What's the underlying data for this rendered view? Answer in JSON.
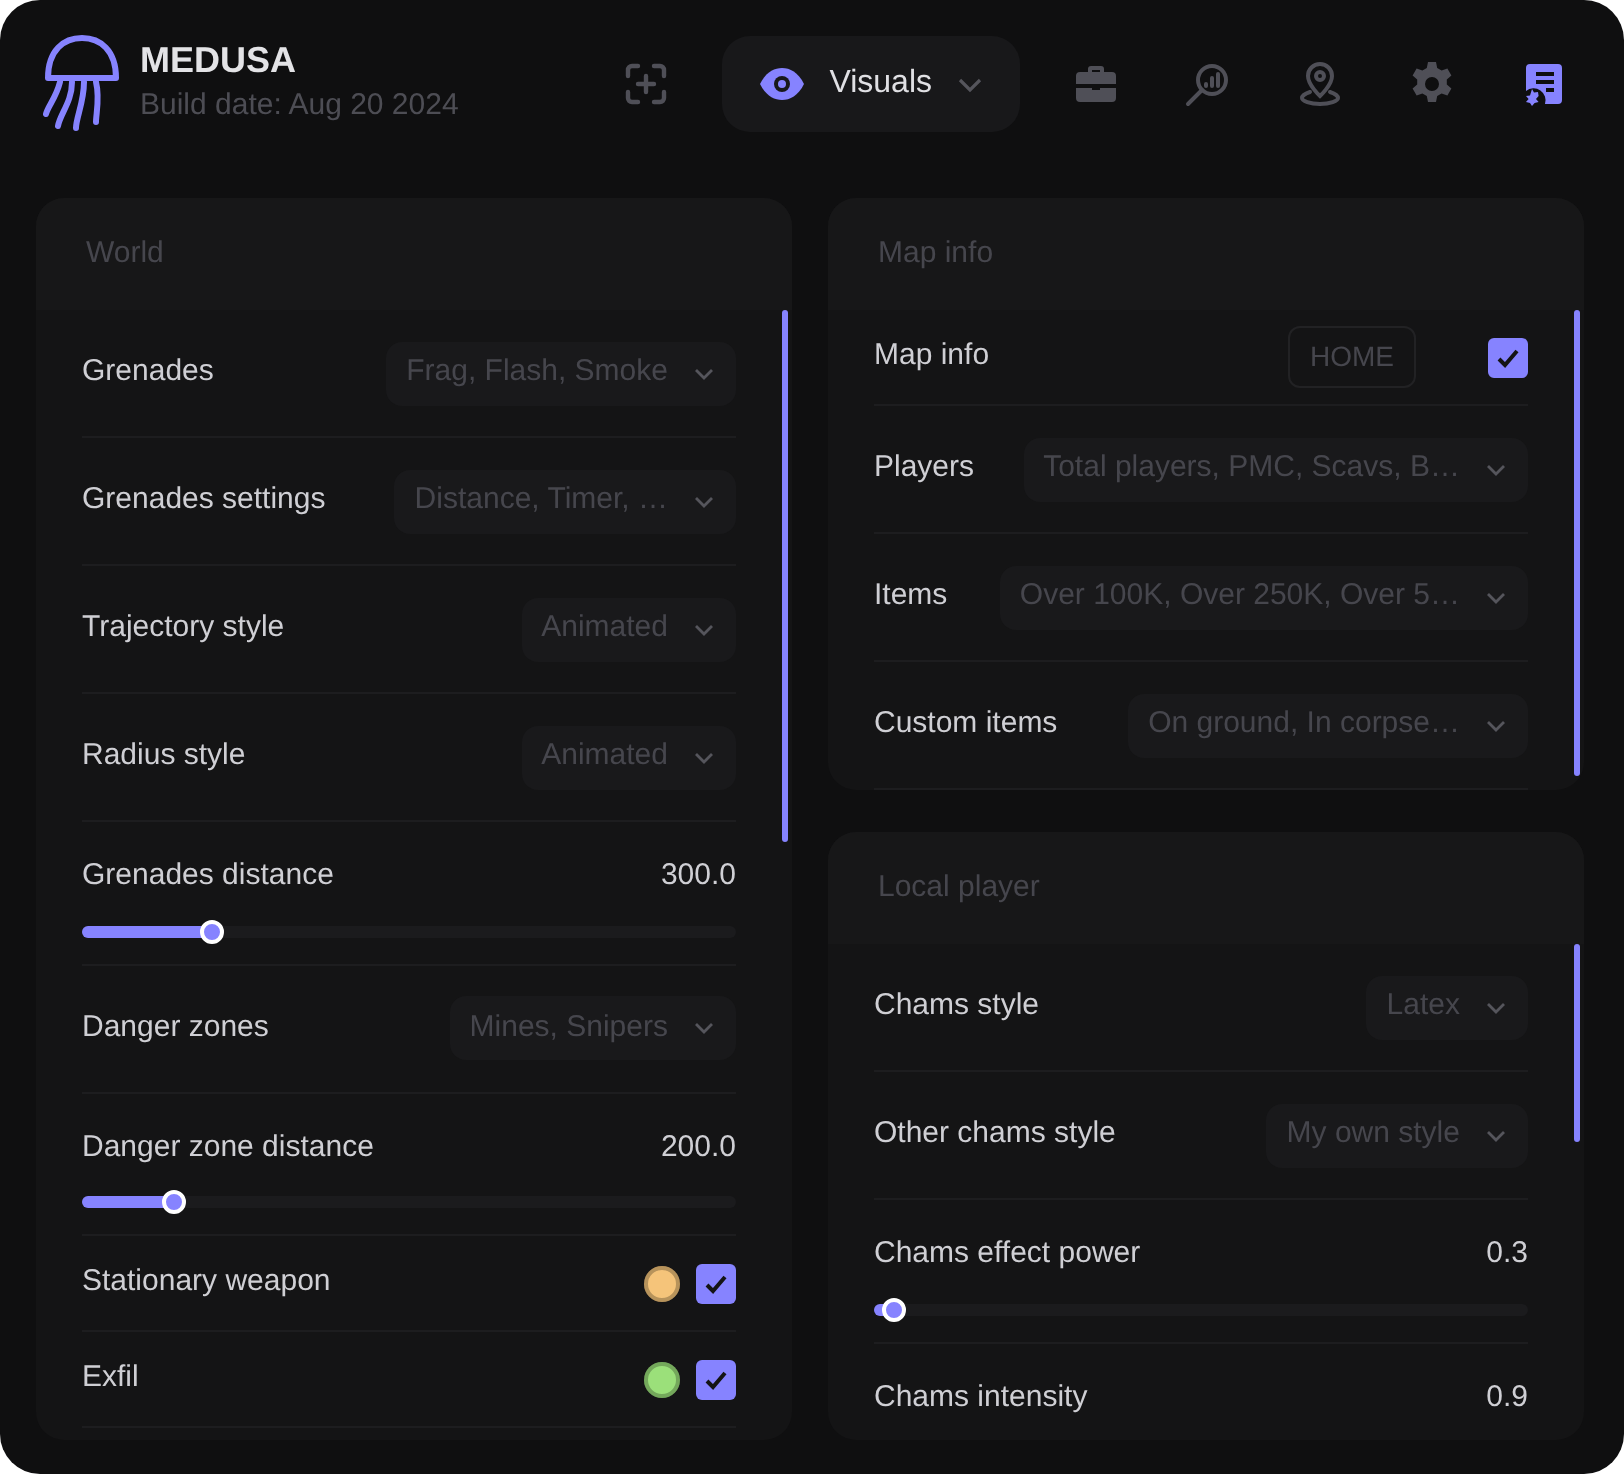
{
  "header": {
    "title": "MEDUSA",
    "subtitle": "Build date: Aug 20 2024"
  },
  "nav": [
    {
      "selected": false,
      "highlighted": false
    },
    {
      "label": "Visuals",
      "selected": true,
      "highlighted": false
    },
    {
      "selected": false,
      "highlighted": false
    },
    {
      "selected": false,
      "highlighted": false
    },
    {
      "selected": false,
      "highlighted": false
    },
    {
      "selected": false,
      "highlighted": false
    },
    {
      "selected": false,
      "highlighted": true
    }
  ],
  "columns": [
    [
      {
        "title": "World",
        "rows": [
          {
            "kind": "select",
            "label": "Grenades",
            "value": "Frag, Flash, Smoke"
          },
          {
            "kind": "select",
            "label": "Grenades settings",
            "value": "Distance, Timer, …"
          },
          {
            "kind": "select",
            "label": "Trajectory style",
            "value": "Animated"
          },
          {
            "kind": "select",
            "label": "Radius style",
            "value": "Animated"
          },
          {
            "kind": "slider",
            "label": "Grenades distance",
            "reading": "300.0",
            "level": 0.2
          },
          {
            "kind": "select",
            "label": "Danger zones",
            "value": "Mines, Snipers"
          },
          {
            "kind": "slider",
            "label": "Danger zone distance",
            "reading": "200.0",
            "level": 0.14
          },
          {
            "kind": "check",
            "label": "Stationary weapon",
            "color": "#f5c47a",
            "checked": true
          },
          {
            "kind": "check",
            "label": "Exfil",
            "color": "#9be07a",
            "checked": true
          }
        ]
      }
    ],
    [
      {
        "title": "Map info",
        "rows": [
          {
            "kind": "check",
            "label": "Map info",
            "hotkey": "HOME",
            "checked": true
          },
          {
            "kind": "select",
            "label": "Players",
            "value": "Total players, PMC, Scavs, B…"
          },
          {
            "kind": "select",
            "label": "Items",
            "value": "Over 100K, Over 250K, Over 5…"
          },
          {
            "kind": "select",
            "label": "Custom items",
            "value": "On ground, In corpse…"
          }
        ]
      },
      {
        "title": "Local player",
        "rows": [
          {
            "kind": "select",
            "label": "Chams style",
            "value": "Latex"
          },
          {
            "kind": "select",
            "label": "Other chams style",
            "value": "My own style"
          },
          {
            "kind": "slider",
            "label": "Chams effect power",
            "reading": "0.3",
            "level": 0.03
          },
          {
            "kind": "slider",
            "label": "Chams intensity",
            "reading": "0.9"
          }
        ]
      }
    ]
  ]
}
